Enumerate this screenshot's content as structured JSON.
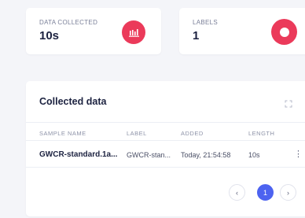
{
  "stats": [
    {
      "label": "DATA COLLECTED",
      "value": "10s",
      "icon": "bar-chart-icon",
      "color": "#eb3a5a"
    },
    {
      "label": "LABELS",
      "value": "1",
      "icon": "pie-chart-icon",
      "color": "#eb3a5a"
    }
  ],
  "collected": {
    "title": "Collected data",
    "columns": [
      "SAMPLE NAME",
      "LABEL",
      "ADDED",
      "LENGTH"
    ],
    "rows": [
      {
        "sample_name": "GWCR-standard.1a...",
        "label": "GWCR-stan...",
        "added": "Today, 21:54:58",
        "length": "10s"
      }
    ],
    "pagination": {
      "prev": "‹",
      "current": "1",
      "next": "›"
    }
  },
  "colors": {
    "accent": "#4d63f0",
    "icon_bg": "#eb3a5a"
  }
}
